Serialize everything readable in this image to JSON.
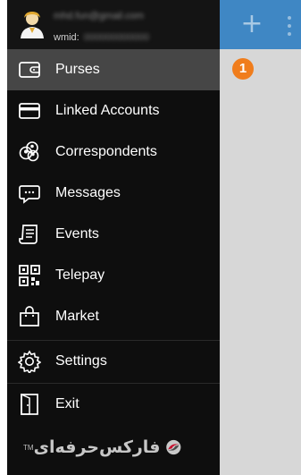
{
  "header": {
    "email": "mhd.fun@gmail.com",
    "wmid_label": "wmid:",
    "wmid_value": "000000000000"
  },
  "menu": [
    {
      "label": "Purses",
      "icon": "wallet-icon",
      "active": true
    },
    {
      "label": "Linked Accounts",
      "icon": "card-icon",
      "active": false
    },
    {
      "label": "Correspondents",
      "icon": "people-icon",
      "active": false
    },
    {
      "label": "Messages",
      "icon": "chat-icon",
      "active": false
    },
    {
      "label": "Events",
      "icon": "scroll-icon",
      "active": false
    },
    {
      "label": "Telepay",
      "icon": "qr-icon",
      "active": false
    },
    {
      "label": "Market",
      "icon": "bag-icon",
      "active": false
    },
    {
      "label": "Settings",
      "icon": "gear-icon",
      "active": false
    },
    {
      "label": "Exit",
      "icon": "door-icon",
      "active": false
    }
  ],
  "app": {
    "badge": "1"
  },
  "watermark": {
    "text": "فارکس‌حرفه‌ای",
    "tm": "TM"
  },
  "colors": {
    "drawer_bg": "#0e0e0e",
    "active_bg": "#464646",
    "toolbar": "#3f87c4",
    "badge": "#f07d1c"
  }
}
